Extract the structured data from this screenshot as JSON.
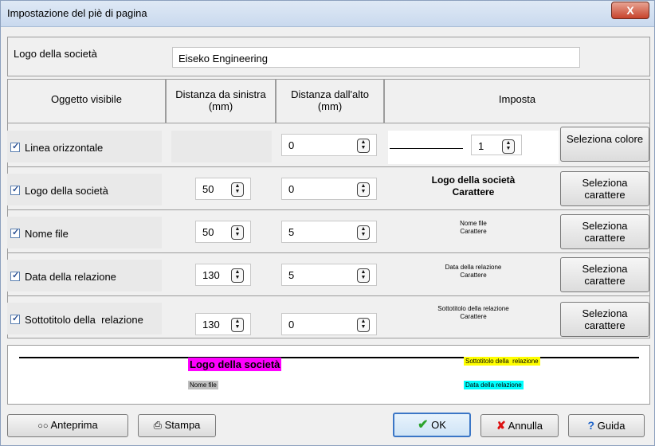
{
  "window": {
    "title": "Impostazione del piè di pagina",
    "close_label": "X"
  },
  "company": {
    "label": "Logo della società",
    "value": "Eiseko Engineering"
  },
  "headers": {
    "visible": "Oggetto visibile",
    "left_distance": "Distanza da sinistra\n(mm)",
    "top_distance": "Distanza dall'alto\n(mm)",
    "set": "Imposta"
  },
  "rows": [
    {
      "label": "Linea orizzontale",
      "checked": true,
      "left": "",
      "top": "0",
      "setting_type": "line",
      "line_width": "1",
      "button": "Seleziona colore"
    },
    {
      "label": "Logo della società",
      "checked": true,
      "left": "50",
      "top": "0",
      "sample": "Logo della società\nCarattere",
      "button": "Seleziona\ncarattere"
    },
    {
      "label": "Nome file",
      "checked": true,
      "left": "50",
      "top": "5",
      "sample": "Nome file\nCarattere",
      "button": "Seleziona\ncarattere"
    },
    {
      "label": "Data della relazione",
      "checked": true,
      "left": "130",
      "top": "5",
      "sample": "Data della relazione\nCarattere",
      "button": "Seleziona\ncarattere"
    },
    {
      "label": "Sottotitolo della  relazione",
      "checked": true,
      "left": "130",
      "top": "0",
      "sample": "Sottotitolo della  relazione\nCarattere",
      "button": "Seleziona\ncarattere"
    }
  ],
  "preview": {
    "company_logo": "Logo della società",
    "file_name": "Nome file",
    "subtitle": "Sottotitolo della  relazione",
    "report_date": "Data della relazione",
    "colors": {
      "logo_bg": "#ff00ff",
      "subtitle_bg": "#ffff00",
      "date_bg": "#00ffff",
      "file_bg": "#c0c0c0"
    }
  },
  "buttons": {
    "preview": "Anteprima",
    "print": "Stampa",
    "ok": "OK",
    "cancel": "Annulla",
    "help": "Guida"
  },
  "icons": {
    "preview": "glasses-icon",
    "print": "printer-icon",
    "ok": "check-icon",
    "cancel": "x-icon",
    "help": "question-icon"
  }
}
